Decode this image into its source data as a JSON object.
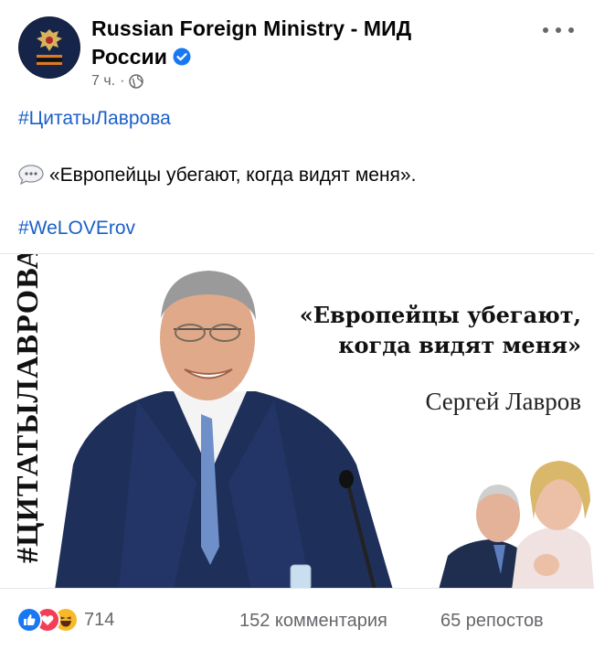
{
  "post": {
    "page_name_line1": "Russian Foreign Ministry - МИД",
    "page_name_line2": "России",
    "timestamp": "7 ч.",
    "separator": "·",
    "hashtag_top": "#ЦитатыЛаврова",
    "quote_text": "«Европейцы убегают, когда видят меня».",
    "hashtag_bottom": "#WeLOVErov"
  },
  "image": {
    "vertical_tag": "#ЦИТАТЫЛАВРОВА",
    "quote_line1": "«Европейцы убегают,",
    "quote_line2": "когда видят меня»",
    "author": "Сергей Лавров"
  },
  "footer": {
    "reaction_count": "714",
    "comments": "152 комментария",
    "shares": "65 репостов"
  },
  "colors": {
    "link": "#1b5fc9",
    "meta_gray": "#65676b",
    "verified": "#1877f2",
    "like": "#1877f2",
    "love": "#f33e58",
    "haha": "#f7b928"
  },
  "icons": [
    "coat-of-arms-icon",
    "verified-icon",
    "globe-icon",
    "more-icon",
    "speech-bubble-icon",
    "like-icon",
    "love-icon",
    "haha-icon"
  ]
}
